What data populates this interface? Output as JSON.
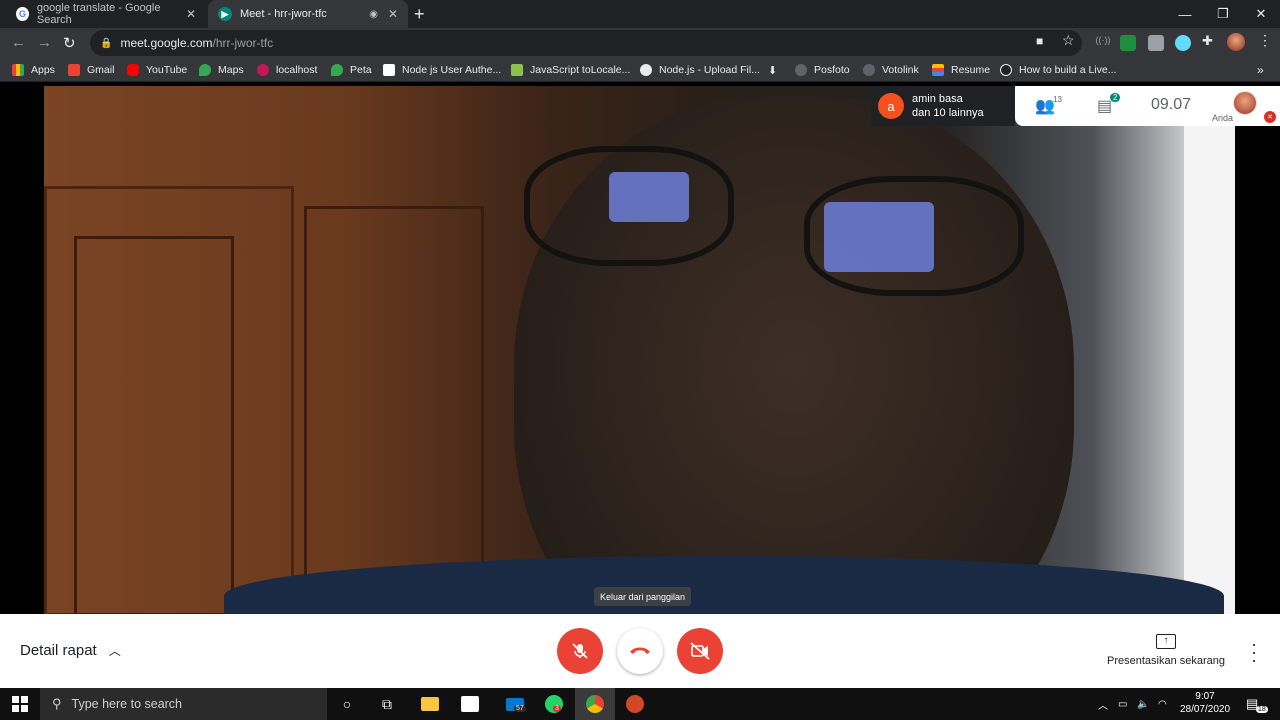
{
  "browser": {
    "tabs": [
      {
        "title": "google translate - Google Search",
        "icon": "google-g-icon"
      },
      {
        "title": "Meet - hrr-jwor-tfc",
        "icon": "meet-icon"
      }
    ],
    "url_host": "meet.google.com",
    "url_path": "/hrr-jwor-tfc",
    "bookmarks": [
      {
        "label": "Apps",
        "color": "#e8eaed"
      },
      {
        "label": "Gmail",
        "color": "#ea4335"
      },
      {
        "label": "YouTube",
        "color": "#ff0000"
      },
      {
        "label": "Maps",
        "color": "#34a853"
      },
      {
        "label": "localhost",
        "color": "#c2185b"
      },
      {
        "label": "Peta",
        "color": "#34a853"
      },
      {
        "label": "Node js User Authe...",
        "color": "#ffffff"
      },
      {
        "label": "JavaScript toLocale...",
        "color": "#8bc34a"
      },
      {
        "label": "Node.js - Upload Fil...",
        "color": "#e8eaed"
      },
      {
        "label": "",
        "color": "#e8eaed"
      },
      {
        "label": "Posfoto",
        "color": "#5f6368"
      },
      {
        "label": "Votolink",
        "color": "#5f6368"
      },
      {
        "label": "Resume",
        "color": "#fbbc04"
      },
      {
        "label": "How to build a Live...",
        "color": "#202124"
      }
    ]
  },
  "meet": {
    "speaker_initial": "a",
    "speaker_name": "amin basa",
    "speaker_others": "dan 10 lainnya",
    "participants_count": "13",
    "chat_badge": "2",
    "time": "09.07",
    "self_label": "Anda",
    "tooltip": "Keluar dari panggilan",
    "meeting_details": "Detail rapat",
    "present_label": "Presentasikan sekarang",
    "colors": {
      "red": "#ea4335",
      "teal": "#00897b"
    }
  },
  "taskbar": {
    "search_placeholder": "Type here to search",
    "mail_badge": "57",
    "whatsapp_badge": "3",
    "time": "9:07",
    "date": "28/07/2020",
    "notif_count": "18"
  }
}
